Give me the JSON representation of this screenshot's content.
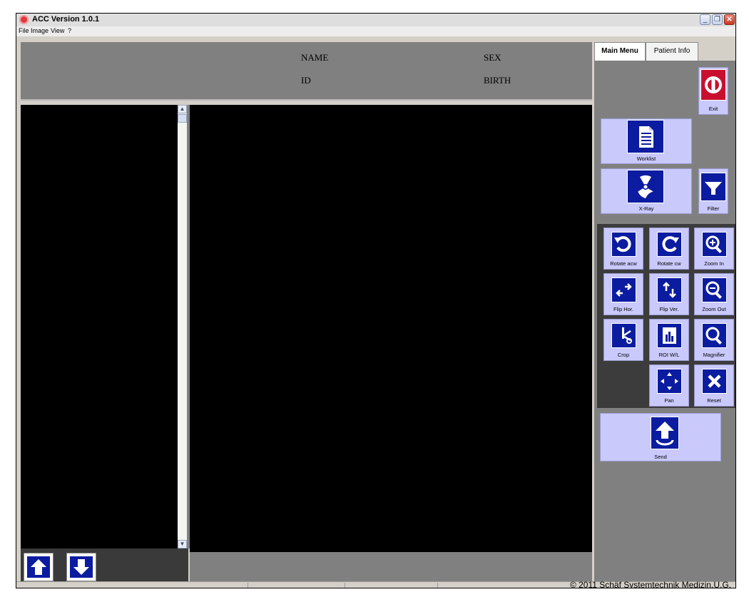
{
  "window": {
    "title": "ACC Version 1.0.1"
  },
  "menu": {
    "items": [
      "File",
      "Image",
      "View",
      "?"
    ]
  },
  "patient_header": {
    "name_label": "NAME",
    "sex_label": "SEX",
    "id_label": "ID",
    "birth_label": "BIRTH"
  },
  "tabs": [
    {
      "label": "Main Menu",
      "active": true
    },
    {
      "label": "Patient Info",
      "active": false
    }
  ],
  "buttons": {
    "exit": "Exit",
    "worklist": "Worklist",
    "xray": "X-Ray",
    "filter": "Filter",
    "rotate_acw": "Rotate acw",
    "rotate_cw": "Rotate cw",
    "zoom_in": "Zoom In",
    "flip_hor": "Flip Hor.",
    "flip_ver": "Flip Ver.",
    "zoom_out": "Zoom Out",
    "crop": "Crop",
    "roi_wl": "ROI W/L",
    "magnifier": "Magnifier",
    "pan": "Pan",
    "reset": "Reset",
    "send": "Send"
  },
  "status": {
    "copyright": "© 2011 Schäf Systemtechnik Medizin.U.G."
  },
  "colors": {
    "accent_blue": "#0b1ca0",
    "button_lavender": "#c9c9fb",
    "exit_red": "#c8102e",
    "panel_gray": "#808080"
  }
}
